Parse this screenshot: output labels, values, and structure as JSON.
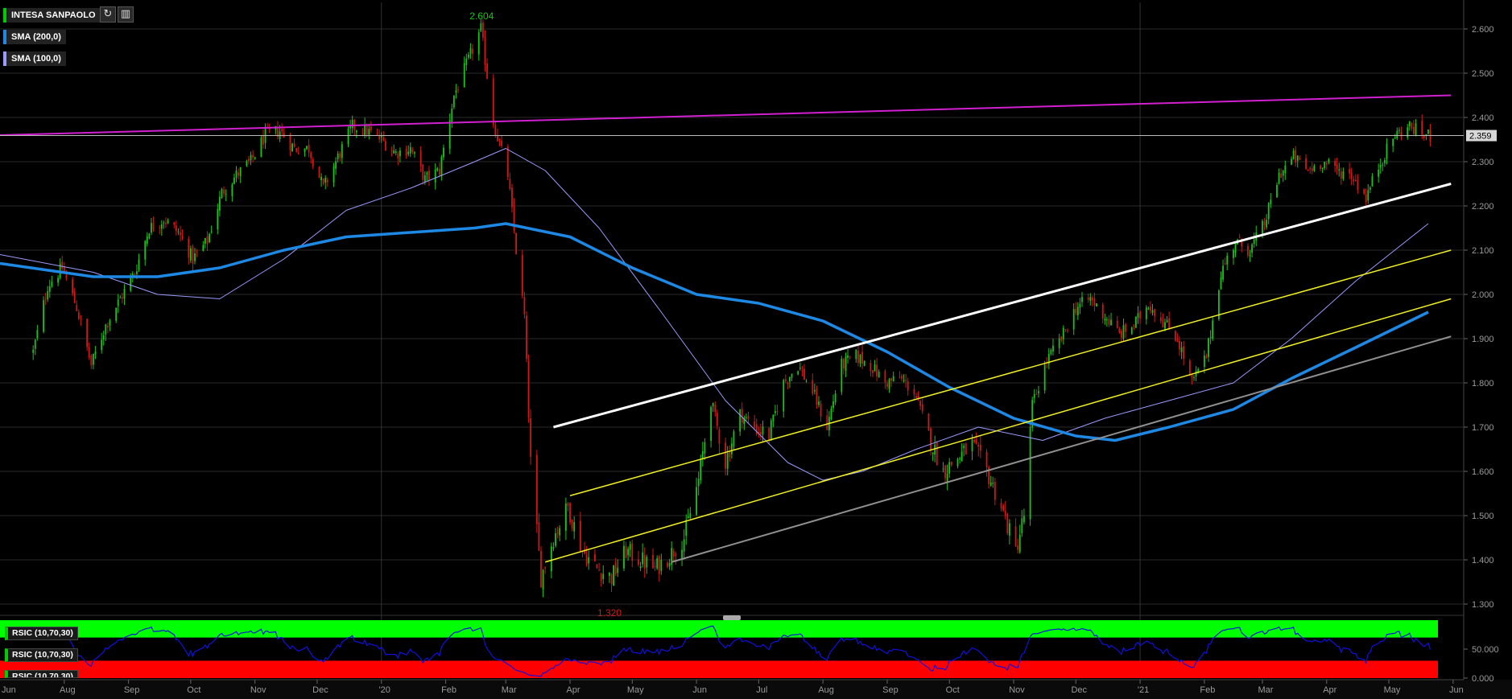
{
  "instrument": {
    "name": "INTESA SANPAOLO"
  },
  "indicators": [
    {
      "name": "SMA (200,0)",
      "color": "#1e88e5"
    },
    {
      "name": "SMA (100,0)",
      "color": "#9a9aff"
    }
  ],
  "toolbar": {
    "refresh_icon": "refresh-icon",
    "settings_icon": "bar-chart-icon"
  },
  "rsi_labels": [
    "RSIC (10,70,30)",
    "RSIC (10,70,30)",
    "RSIC (10,70,30)"
  ],
  "colors": {
    "up": "#19c419",
    "down": "#d01818",
    "rsi_over": "#00ff00",
    "rsi_under": "#ff0000",
    "rsi_line": "#1010e0",
    "resistance": "#d020d0",
    "channel_white": "#ffffff",
    "channel_yellow": "#f0f020",
    "channel_gray": "#909090"
  },
  "chart_data": {
    "type": "candlestick",
    "x_ticks": [
      "Aug",
      "Sep",
      "Oct",
      "Nov",
      "Dec",
      "'20",
      "Feb",
      "Mar",
      "Apr",
      "May",
      "Jun",
      "Jul",
      "Aug",
      "Sep",
      "Oct",
      "Nov",
      "Dec",
      "'21",
      "Feb",
      "Mar",
      "Apr",
      "May",
      "Jun"
    ],
    "y_ticks": [
      "2.600",
      "2.500",
      "2.400",
      "2.300",
      "2.200",
      "2.100",
      "2.000",
      "1.900",
      "1.800",
      "1.700",
      "1.600",
      "1.500",
      "1.400",
      "1.300"
    ],
    "ylim": [
      1.28,
      2.66
    ],
    "last_price": "2.359",
    "max_label": "2.604",
    "min_label": "1.320",
    "price_path": [
      [
        "2019-07-17",
        1.87
      ],
      [
        "2019-07-24",
        2.02
      ],
      [
        "2019-07-31",
        2.06
      ],
      [
        "2019-08-07",
        1.97
      ],
      [
        "2019-08-14",
        1.84
      ],
      [
        "2019-08-21",
        1.93
      ],
      [
        "2019-08-28",
        1.99
      ],
      [
        "2019-09-04",
        2.05
      ],
      [
        "2019-09-11",
        2.15
      ],
      [
        "2019-09-18",
        2.17
      ],
      [
        "2019-09-25",
        2.14
      ],
      [
        "2019-10-02",
        2.08
      ],
      [
        "2019-10-09",
        2.12
      ],
      [
        "2019-10-16",
        2.23
      ],
      [
        "2019-10-23",
        2.27
      ],
      [
        "2019-10-30",
        2.3
      ],
      [
        "2019-11-06",
        2.36
      ],
      [
        "2019-11-13",
        2.37
      ],
      [
        "2019-11-20",
        2.33
      ],
      [
        "2019-11-27",
        2.33
      ],
      [
        "2019-12-04",
        2.24
      ],
      [
        "2019-12-11",
        2.31
      ],
      [
        "2019-12-18",
        2.38
      ],
      [
        "2019-12-25",
        2.37
      ],
      [
        "2020-01-01",
        2.35
      ],
      [
        "2020-01-08",
        2.32
      ],
      [
        "2020-01-15",
        2.33
      ],
      [
        "2020-01-22",
        2.26
      ],
      [
        "2020-01-29",
        2.28
      ],
      [
        "2020-02-05",
        2.45
      ],
      [
        "2020-02-12",
        2.53
      ],
      [
        "2020-02-18",
        2.6
      ],
      [
        "2020-02-24",
        2.39
      ],
      [
        "2020-03-02",
        2.27
      ],
      [
        "2020-03-06",
        2.1
      ],
      [
        "2020-03-10",
        1.95
      ],
      [
        "2020-03-13",
        1.62
      ],
      [
        "2020-03-18",
        1.36
      ],
      [
        "2020-03-24",
        1.45
      ],
      [
        "2020-03-31",
        1.52
      ],
      [
        "2020-04-07",
        1.42
      ],
      [
        "2020-04-14",
        1.38
      ],
      [
        "2020-04-21",
        1.36
      ],
      [
        "2020-04-28",
        1.42
      ],
      [
        "2020-05-05",
        1.4
      ],
      [
        "2020-05-12",
        1.38
      ],
      [
        "2020-05-19",
        1.41
      ],
      [
        "2020-05-26",
        1.45
      ],
      [
        "2020-06-02",
        1.58
      ],
      [
        "2020-06-08",
        1.76
      ],
      [
        "2020-06-15",
        1.62
      ],
      [
        "2020-06-22",
        1.73
      ],
      [
        "2020-06-29",
        1.7
      ],
      [
        "2020-07-06",
        1.68
      ],
      [
        "2020-07-13",
        1.8
      ],
      [
        "2020-07-20",
        1.84
      ],
      [
        "2020-07-27",
        1.78
      ],
      [
        "2020-08-03",
        1.7
      ],
      [
        "2020-08-10",
        1.84
      ],
      [
        "2020-08-17",
        1.86
      ],
      [
        "2020-08-24",
        1.84
      ],
      [
        "2020-08-31",
        1.8
      ],
      [
        "2020-09-07",
        1.81
      ],
      [
        "2020-09-14",
        1.78
      ],
      [
        "2020-09-21",
        1.68
      ],
      [
        "2020-09-28",
        1.6
      ],
      [
        "2020-10-05",
        1.63
      ],
      [
        "2020-10-12",
        1.66
      ],
      [
        "2020-10-19",
        1.6
      ],
      [
        "2020-10-26",
        1.52
      ],
      [
        "2020-11-02",
        1.42
      ],
      [
        "2020-11-06",
        1.5
      ],
      [
        "2020-11-10",
        1.75
      ],
      [
        "2020-11-17",
        1.85
      ],
      [
        "2020-11-24",
        1.9
      ],
      [
        "2020-12-01",
        1.97
      ],
      [
        "2020-12-08",
        1.99
      ],
      [
        "2020-12-15",
        1.95
      ],
      [
        "2020-12-22",
        1.91
      ],
      [
        "2020-12-29",
        1.93
      ],
      [
        "2021-01-05",
        1.98
      ],
      [
        "2021-01-12",
        1.94
      ],
      [
        "2021-01-19",
        1.9
      ],
      [
        "2021-01-26",
        1.8
      ],
      [
        "2021-02-02",
        1.86
      ],
      [
        "2021-02-09",
        2.05
      ],
      [
        "2021-02-16",
        2.12
      ],
      [
        "2021-02-23",
        2.1
      ],
      [
        "2021-03-02",
        2.16
      ],
      [
        "2021-03-09",
        2.27
      ],
      [
        "2021-03-16",
        2.31
      ],
      [
        "2021-03-23",
        2.28
      ],
      [
        "2021-03-30",
        2.3
      ],
      [
        "2021-04-06",
        2.28
      ],
      [
        "2021-04-13",
        2.27
      ],
      [
        "2021-04-20",
        2.22
      ],
      [
        "2021-04-27",
        2.3
      ],
      [
        "2021-05-04",
        2.36
      ],
      [
        "2021-05-11",
        2.38
      ],
      [
        "2021-05-18",
        2.36
      ],
      [
        "2021-05-21",
        2.359
      ]
    ],
    "sma200": [
      [
        "2019-07-01",
        2.07
      ],
      [
        "2019-08-15",
        2.04
      ],
      [
        "2019-09-15",
        2.04
      ],
      [
        "2019-10-15",
        2.06
      ],
      [
        "2019-11-15",
        2.1
      ],
      [
        "2019-12-15",
        2.13
      ],
      [
        "2020-01-15",
        2.14
      ],
      [
        "2020-02-15",
        2.15
      ],
      [
        "2020-03-01",
        2.16
      ],
      [
        "2020-04-01",
        2.13
      ],
      [
        "2020-05-01",
        2.06
      ],
      [
        "2020-06-01",
        2.0
      ],
      [
        "2020-07-01",
        1.98
      ],
      [
        "2020-08-01",
        1.94
      ],
      [
        "2020-09-01",
        1.87
      ],
      [
        "2020-10-01",
        1.79
      ],
      [
        "2020-11-01",
        1.72
      ],
      [
        "2020-12-01",
        1.68
      ],
      [
        "2020-12-20",
        1.67
      ],
      [
        "2021-01-15",
        1.7
      ],
      [
        "2021-02-15",
        1.74
      ],
      [
        "2021-03-15",
        1.81
      ],
      [
        "2021-04-15",
        1.88
      ],
      [
        "2021-05-20",
        1.96
      ]
    ],
    "sma100": [
      [
        "2019-07-01",
        2.09
      ],
      [
        "2019-08-15",
        2.05
      ],
      [
        "2019-09-15",
        2.0
      ],
      [
        "2019-10-15",
        1.99
      ],
      [
        "2019-11-15",
        2.08
      ],
      [
        "2019-12-15",
        2.19
      ],
      [
        "2020-01-15",
        2.24
      ],
      [
        "2020-02-15",
        2.3
      ],
      [
        "2020-03-01",
        2.33
      ],
      [
        "2020-03-20",
        2.28
      ],
      [
        "2020-04-15",
        2.15
      ],
      [
        "2020-05-15",
        1.96
      ],
      [
        "2020-06-15",
        1.76
      ],
      [
        "2020-07-15",
        1.62
      ],
      [
        "2020-08-01",
        1.58
      ],
      [
        "2020-08-20",
        1.6
      ],
      [
        "2020-09-15",
        1.65
      ],
      [
        "2020-10-15",
        1.7
      ],
      [
        "2020-11-15",
        1.67
      ],
      [
        "2020-12-15",
        1.72
      ],
      [
        "2021-01-15",
        1.76
      ],
      [
        "2021-02-15",
        1.8
      ],
      [
        "2021-03-15",
        1.9
      ],
      [
        "2021-04-15",
        2.03
      ],
      [
        "2021-05-20",
        2.16
      ]
    ],
    "trendlines": [
      {
        "color": "#d020d0",
        "width": 2,
        "from": [
          "2019-07-01",
          2.36
        ],
        "to": [
          "2021-05-31",
          2.45
        ]
      },
      {
        "color": "#ffffff",
        "width": 3,
        "from": [
          "2020-03-24",
          1.7
        ],
        "to": [
          "2021-05-31",
          2.25
        ]
      },
      {
        "color": "#f0f020",
        "width": 1.5,
        "from": [
          "2020-04-01",
          1.545
        ],
        "to": [
          "2021-05-31",
          2.1
        ]
      },
      {
        "color": "#f0f020",
        "width": 1.5,
        "from": [
          "2020-03-20",
          1.395
        ],
        "to": [
          "2021-05-31",
          1.99
        ]
      },
      {
        "color": "#909090",
        "width": 2,
        "from": [
          "2020-05-20",
          1.395
        ],
        "to": [
          "2021-05-31",
          1.905
        ]
      }
    ],
    "rsi": {
      "ylim": [
        0,
        100
      ],
      "y_ticks": [
        "50.000",
        "0.000"
      ],
      "overbought": 70,
      "oversold": 30
    },
    "grid": true
  }
}
